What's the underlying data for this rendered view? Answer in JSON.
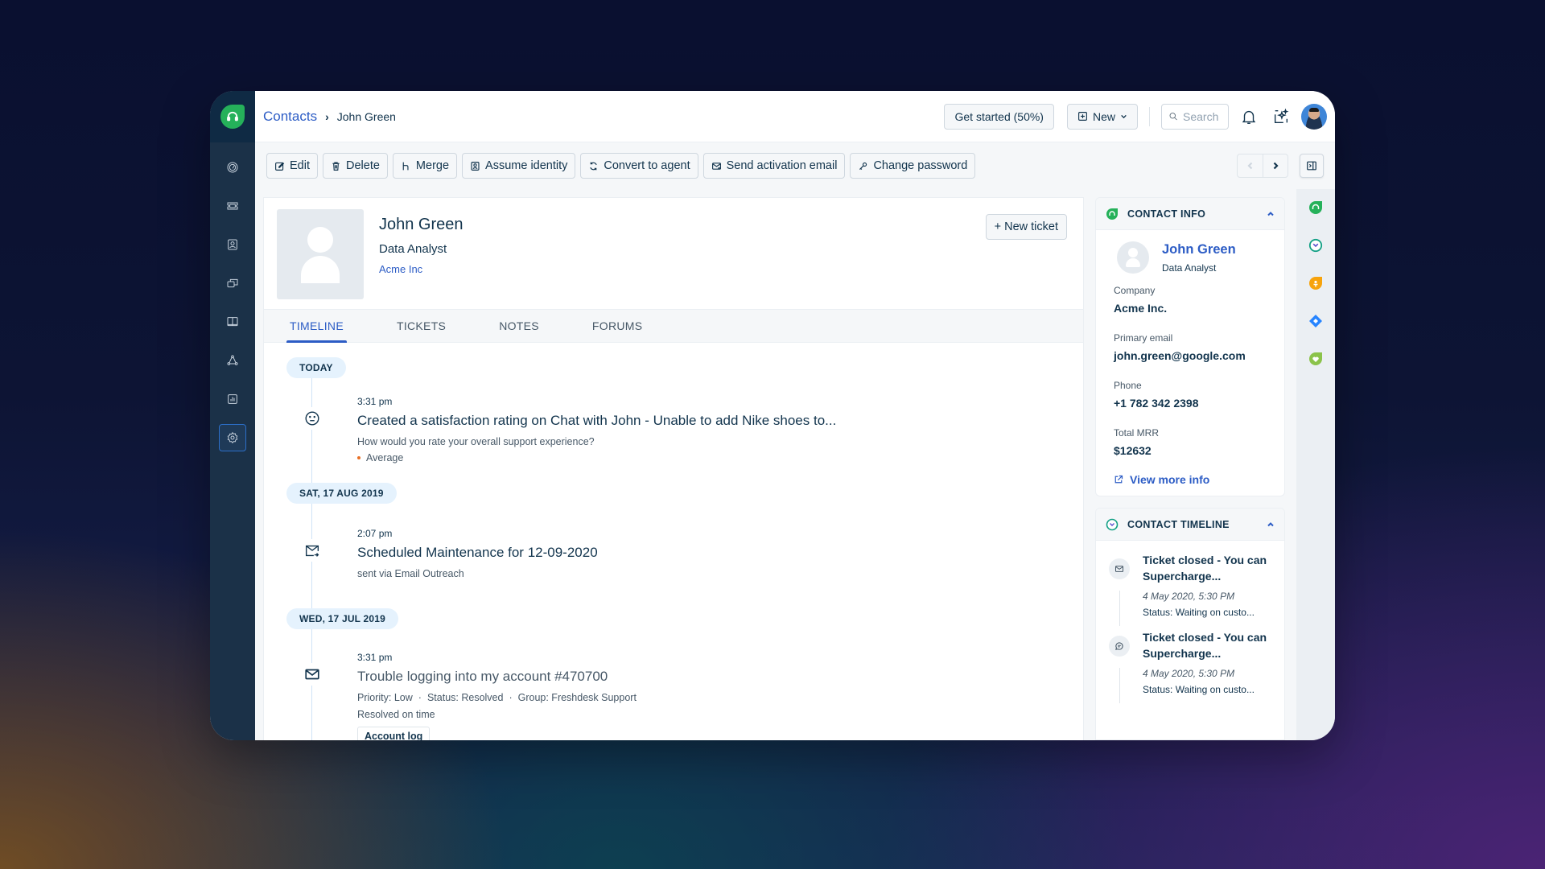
{
  "nav": {
    "logo": "freshdesk-logo-icon",
    "items": [
      {
        "name": "dashboard",
        "icon": "gauge-icon"
      },
      {
        "name": "tickets",
        "icon": "ticket-icon"
      },
      {
        "name": "contacts",
        "icon": "contact-card-icon"
      },
      {
        "name": "discussions",
        "icon": "chat-boxes-icon"
      },
      {
        "name": "solutions",
        "icon": "book-icon"
      },
      {
        "name": "social",
        "icon": "network-icon"
      },
      {
        "name": "reports",
        "icon": "bar-chart-icon"
      },
      {
        "name": "admin",
        "icon": "gear-icon",
        "active": true
      }
    ]
  },
  "header": {
    "breadcrumb": {
      "parent": "Contacts",
      "current": "John Green"
    },
    "get_started": "Get started (50%)",
    "new_label": "New",
    "search_placeholder": "Search"
  },
  "toolbar": {
    "actions": [
      {
        "label": "Edit",
        "icon": "edit-icon"
      },
      {
        "label": "Delete",
        "icon": "trash-icon"
      },
      {
        "label": "Merge",
        "icon": "merge-icon"
      },
      {
        "label": "Assume identity",
        "icon": "identity-icon"
      },
      {
        "label": "Convert to agent",
        "icon": "convert-icon"
      },
      {
        "label": "Send activation email",
        "icon": "email-send-icon"
      },
      {
        "label": "Change password",
        "icon": "key-icon"
      }
    ]
  },
  "profile": {
    "name": "John Green",
    "title": "Data Analyst",
    "company": "Acme Inc",
    "new_ticket_label": "+ New ticket"
  },
  "tabs": [
    {
      "label": "TIMELINE",
      "active": true
    },
    {
      "label": "TICKETS",
      "active": false
    },
    {
      "label": "NOTES",
      "active": false
    },
    {
      "label": "FORUMS",
      "active": false
    }
  ],
  "timeline": [
    {
      "date": "TODAY",
      "events": [
        {
          "time": "3:31 pm",
          "icon": "neutral-face-icon",
          "title": "Created a satisfaction rating on Chat with John - Unable to add Nike shoes to...",
          "desc": "How would you rate your overall support experience?",
          "bullet": "Average"
        }
      ]
    },
    {
      "date": "SAT, 17 AUG 2019",
      "events": [
        {
          "time": "2:07 pm",
          "icon": "email-outreach-icon",
          "title": "Scheduled Maintenance for 12-09-2020",
          "desc": "sent via Email Outreach"
        }
      ]
    },
    {
      "date": "WED, 17 JUL 2019",
      "events": [
        {
          "time": "3:31 pm",
          "icon": "email-icon",
          "title": "Trouble logging into my account #470700",
          "meta": [
            "Priority: Low",
            "Status: Resolved",
            "Group: Freshdesk Support"
          ],
          "desc2": "Resolved on time",
          "button": "Account log"
        }
      ]
    }
  ],
  "contact_info": {
    "heading": "CONTACT INFO",
    "name": "John Green",
    "title": "Data Analyst",
    "fields": [
      {
        "label": "Company",
        "value": "Acme Inc."
      },
      {
        "label": "Primary email",
        "value": "john.green@google.com"
      },
      {
        "label": "Phone",
        "value": "+1 782 342 2398"
      },
      {
        "label": "Total MRR",
        "value": "$12632"
      }
    ],
    "more_link": "View more info"
  },
  "contact_timeline": {
    "heading": "CONTACT TIMELINE",
    "items": [
      {
        "icon": "email-icon",
        "title": "Ticket closed - You can Supercharge...",
        "date": "4 May 2020, 5:30 PM",
        "status": "Status: Waiting on custo..."
      },
      {
        "icon": "chat-icon",
        "title": "Ticket closed - You can Supercharge...",
        "date": "4 May 2020, 5:30 PM",
        "status": "Status: Waiting on custo..."
      }
    ]
  },
  "app_rail": [
    {
      "name": "freshdesk-app",
      "color": "#25b15a"
    },
    {
      "name": "freshsales-timeline-app",
      "color": "#13a085"
    },
    {
      "name": "freshcaller-app",
      "color": "#f7a30c"
    },
    {
      "name": "jira-app",
      "color": "#2684ff"
    },
    {
      "name": "freshmarketer-app",
      "color": "#8bc34a"
    }
  ],
  "colors": {
    "brand_green": "#25b15a",
    "link_blue": "#2c5cc5",
    "text_primary": "#12344d",
    "nav_bg": "#1b3148"
  }
}
